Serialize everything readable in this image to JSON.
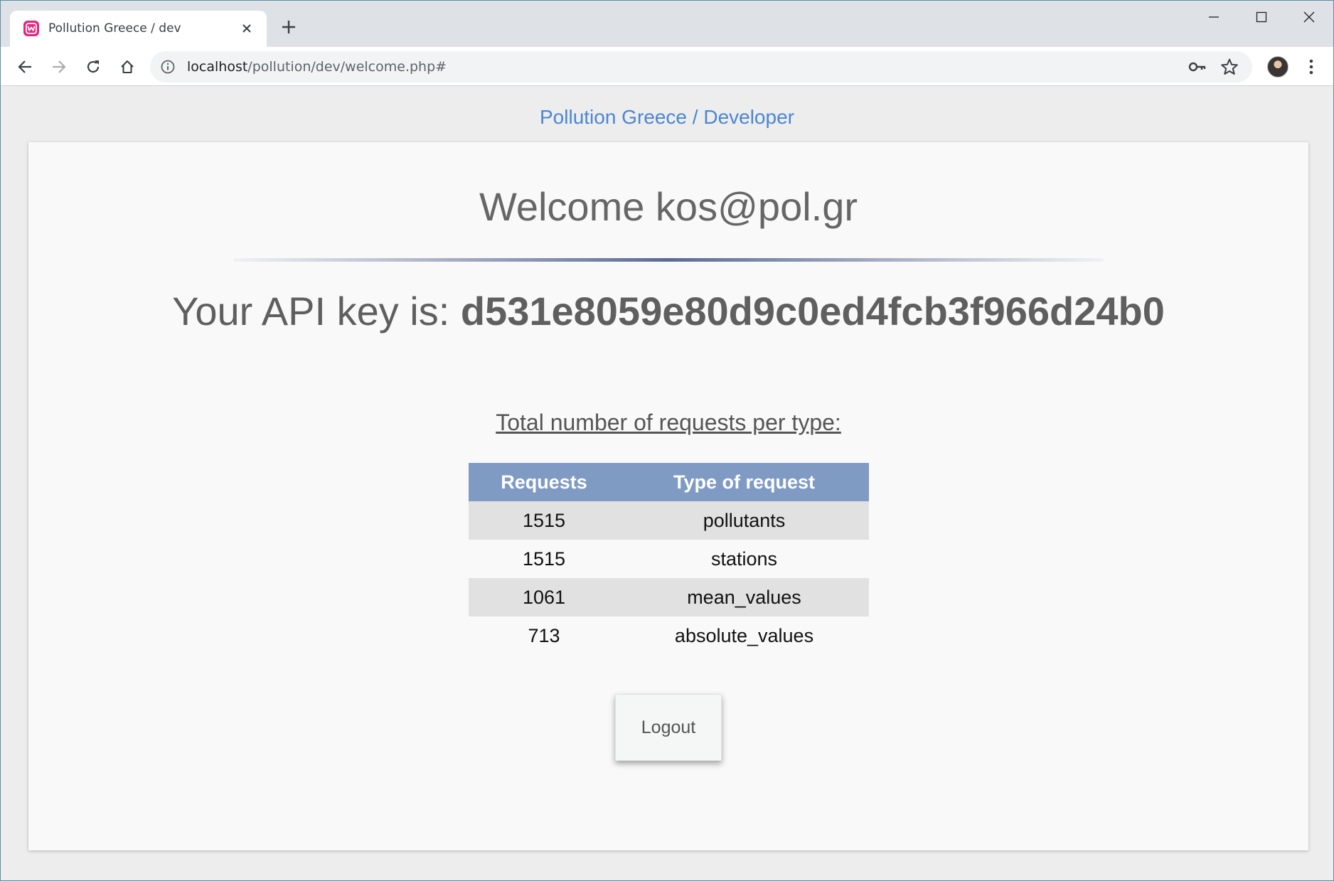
{
  "browser": {
    "tab": {
      "title": "Pollution Greece / dev",
      "favicon": "wamp-icon"
    },
    "url": {
      "host": "localhost",
      "path": "/pollution/dev/welcome.php#"
    },
    "accent": "#e8237c"
  },
  "page": {
    "brand": "Pollution Greece / Developer",
    "welcome": "Welcome kos@pol.gr",
    "api_key_label": "Your API key is: ",
    "api_key": "d531e8059e80d9c0ed4fcb3f966d24b0",
    "requests_title": "Total number of requests per type:",
    "table": {
      "headers": [
        "Requests",
        "Type of request"
      ],
      "rows": [
        [
          "1515",
          "pollutants"
        ],
        [
          "1515",
          "stations"
        ],
        [
          "1061",
          "mean_values"
        ],
        [
          "713",
          "absolute_values"
        ]
      ]
    },
    "logout_label": "Logout"
  },
  "colors": {
    "brand_link": "#4a86d4",
    "table_header": "#7f9bc4",
    "row_stripe": "#e1e1e1"
  }
}
